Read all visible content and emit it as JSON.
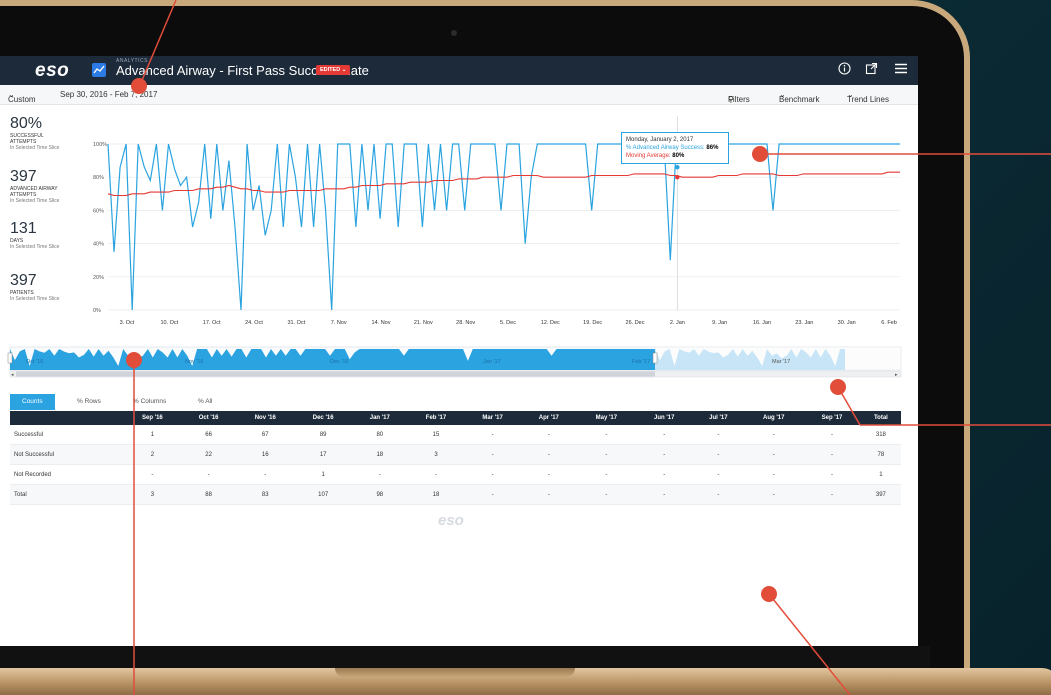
{
  "app": {
    "logo": "eso",
    "app_sub": "ANALYTICS",
    "title": "Advanced Airway - First Pass Success Rate",
    "edited_badge": "EDITED"
  },
  "topbar_icons": [
    "info-icon",
    "external-link-icon",
    "menu-icon"
  ],
  "subbar": {
    "range_type": "Custom",
    "date_range": "Sep 30, 2016  -  Feb 7, 2017",
    "filters": "Filters",
    "benchmark": "Benchmark",
    "trend_lines": "Trend Lines"
  },
  "kpis": [
    {
      "value": "80%",
      "label1": "SUCCESSFUL",
      "label2": "ATTEMPTS",
      "sub": "In Selected Time Slice"
    },
    {
      "value": "397",
      "label1": "ADVANCED AIRWAY",
      "label2": "ATTEMPTS",
      "sub": "In Selected Time Slice"
    },
    {
      "value": "131",
      "label1": "DAYS",
      "label2": "",
      "sub": "In Selected Time Slice"
    },
    {
      "value": "397",
      "label1": "PATIENTS",
      "label2": "",
      "sub": "In Selected Time Slice"
    }
  ],
  "tooltip": {
    "date": "Monday, January 2, 2017",
    "series_label": "% Advanced Airway Success:",
    "series_value": "86%",
    "avg_label": "Moving Average:",
    "avg_value": "80%"
  },
  "chart_data": {
    "type": "line",
    "y_ticks": [
      "100%",
      "80%",
      "60%",
      "40%",
      "20%",
      "0%"
    ],
    "ylim": [
      0,
      100
    ],
    "grid": true,
    "x_ticks": [
      "3. Oct",
      "10. Oct",
      "17. Oct",
      "24. Oct",
      "31. Oct",
      "7. Nov",
      "14. Nov",
      "21. Nov",
      "28. Nov",
      "5. Dec",
      "12. Dec",
      "19. Dec",
      "26. Dec",
      "2. Jan",
      "9. Jan",
      "16. Jan",
      "23. Jan",
      "30. Jan",
      "6. Feb"
    ],
    "series": [
      {
        "color": "#2aa3e0",
        "values": [
          100,
          35,
          86,
          100,
          0,
          100,
          86,
          78,
          100,
          60,
          100,
          85,
          75,
          80,
          50,
          65,
          100,
          55,
          100,
          60,
          90,
          50,
          0,
          100,
          60,
          75,
          45,
          60,
          100,
          50,
          100,
          80,
          50,
          100,
          50,
          100,
          60,
          0,
          100,
          100,
          100,
          50,
          100,
          60,
          100,
          55,
          100,
          100,
          50,
          100,
          100,
          100,
          50,
          100,
          60,
          100,
          60,
          100,
          100,
          60,
          100,
          100,
          100,
          100,
          100,
          60,
          100,
          100,
          100,
          40,
          80,
          100,
          100,
          100,
          100,
          100,
          100,
          100,
          100,
          100,
          60,
          100,
          100,
          100,
          100,
          100,
          100,
          100,
          100,
          100,
          100,
          100,
          100,
          30,
          100,
          100,
          100,
          100,
          100,
          100,
          100,
          100,
          100,
          100,
          100,
          100,
          100,
          100,
          100,
          100,
          60,
          100,
          100,
          100,
          100,
          100,
          100,
          100,
          100,
          100,
          100,
          100,
          100,
          100,
          100,
          100,
          100,
          100,
          100,
          100,
          100,
          100
        ],
        "line_only": false
      },
      {
        "color": "#e53935",
        "values": [
          70,
          69,
          69,
          69,
          70,
          70,
          70,
          71,
          71,
          71,
          71,
          72,
          72,
          72,
          72,
          73,
          73,
          73,
          74,
          74,
          75,
          74,
          73,
          73,
          72,
          72,
          71,
          71,
          71,
          71,
          72,
          72,
          72,
          72,
          72,
          72,
          73,
          73,
          73,
          73,
          74,
          74,
          75,
          75,
          75,
          75,
          76,
          76,
          76,
          76,
          77,
          77,
          77,
          77,
          78,
          78,
          78,
          78,
          79,
          79,
          79,
          79,
          80,
          80,
          80,
          80,
          80,
          81,
          81,
          81,
          81,
          81,
          80,
          80,
          80,
          80,
          80,
          80,
          80,
          80,
          81,
          81,
          81,
          81,
          81,
          81,
          81,
          82,
          82,
          82,
          82,
          82,
          82,
          81,
          81,
          80,
          80,
          80,
          80,
          80,
          80,
          81,
          81,
          81,
          81,
          82,
          82,
          82,
          82,
          82,
          82,
          81,
          81,
          81,
          81,
          82,
          82,
          82,
          82,
          82,
          82,
          82,
          82,
          82,
          82,
          82,
          82,
          82,
          82,
          83,
          83,
          83
        ]
      }
    ]
  },
  "navigator": {
    "labels": [
      "Oct '16",
      "Nov '16",
      "Dec '16",
      "Jan '17",
      "Feb '17",
      "Mar '17"
    ]
  },
  "tabs": [
    {
      "label": "Counts",
      "active": true
    },
    {
      "label": "% Rows",
      "active": false
    },
    {
      "label": "% Columns",
      "active": false
    },
    {
      "label": "% All",
      "active": false
    }
  ],
  "table": {
    "columns": [
      "",
      "Sep '16",
      "Oct '16",
      "Nov '16",
      "Dec '16",
      "Jan '17",
      "Feb '17",
      "Mar '17",
      "Apr '17",
      "May '17",
      "Jun '17",
      "Jul '17",
      "Aug '17",
      "Sep '17",
      "Total"
    ],
    "rows": [
      [
        "Successful",
        "1",
        "66",
        "67",
        "89",
        "80",
        "15",
        "-",
        "-",
        "-",
        "-",
        "-",
        "-",
        "-",
        "318"
      ],
      [
        "Not Successful",
        "2",
        "22",
        "16",
        "17",
        "18",
        "3",
        "-",
        "-",
        "-",
        "-",
        "-",
        "-",
        "-",
        "78"
      ],
      [
        "Not Recorded",
        "-",
        "-",
        "-",
        "1",
        "-",
        "-",
        "-",
        "-",
        "-",
        "-",
        "-",
        "-",
        "-",
        "1"
      ],
      [
        "Total",
        "3",
        "88",
        "83",
        "107",
        "98",
        "18",
        "-",
        "-",
        "-",
        "-",
        "-",
        "-",
        "-",
        "397"
      ]
    ]
  },
  "watermark": "eso"
}
